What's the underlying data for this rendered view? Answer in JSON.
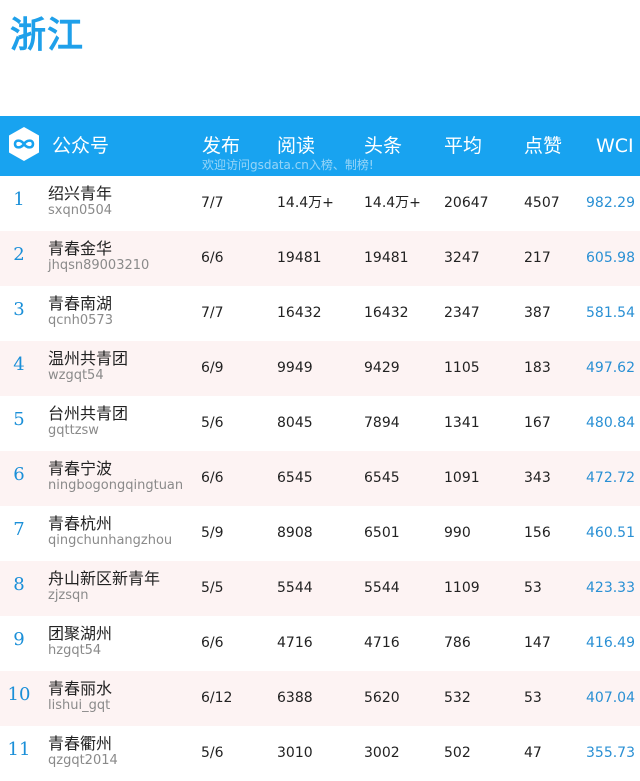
{
  "page": {
    "title": "浙江"
  },
  "header": {
    "account_label": "公众号",
    "publish_label": "发布",
    "read_label": "阅读",
    "top_label": "头条",
    "avg_label": "平均",
    "likes_label": "点赞",
    "wci_label": "WCI",
    "watermark": "欢迎访问gsdata.cn入榜、制榜!",
    "logo_icon": "infinity-logo-icon"
  },
  "colors": {
    "title": "#1fa0ea",
    "header_bg": "#18a3f0",
    "rank": "#1a8fd8",
    "wci": "#2a90d4",
    "alt_row": "#fdf3f3"
  },
  "rows": [
    {
      "rank": "1",
      "name": "绍兴青年",
      "id": "sxqn0504",
      "publish": "7/7",
      "read": "14.4万+",
      "top": "14.4万+",
      "avg": "20647",
      "likes": "4507",
      "wci": "982.29"
    },
    {
      "rank": "2",
      "name": "青春金华",
      "id": "jhqsn89003210",
      "publish": "6/6",
      "read": "19481",
      "top": "19481",
      "avg": "3247",
      "likes": "217",
      "wci": "605.98"
    },
    {
      "rank": "3",
      "name": "青春南湖",
      "id": "qcnh0573",
      "publish": "7/7",
      "read": "16432",
      "top": "16432",
      "avg": "2347",
      "likes": "387",
      "wci": "581.54"
    },
    {
      "rank": "4",
      "name": "温州共青团",
      "id": "wzgqt54",
      "publish": "6/9",
      "read": "9949",
      "top": "9429",
      "avg": "1105",
      "likes": "183",
      "wci": "497.62"
    },
    {
      "rank": "5",
      "name": "台州共青团",
      "id": "gqttzsw",
      "publish": "5/6",
      "read": "8045",
      "top": "7894",
      "avg": "1341",
      "likes": "167",
      "wci": "480.84"
    },
    {
      "rank": "6",
      "name": "青春宁波",
      "id": "ningbogongqingtuan",
      "publish": "6/6",
      "read": "6545",
      "top": "6545",
      "avg": "1091",
      "likes": "343",
      "wci": "472.72"
    },
    {
      "rank": "7",
      "name": "青春杭州",
      "id": "qingchunhangzhou",
      "publish": "5/9",
      "read": "8908",
      "top": "6501",
      "avg": "990",
      "likes": "156",
      "wci": "460.51"
    },
    {
      "rank": "8",
      "name": "舟山新区新青年",
      "id": "zjzsqn",
      "publish": "5/5",
      "read": "5544",
      "top": "5544",
      "avg": "1109",
      "likes": "53",
      "wci": "423.33"
    },
    {
      "rank": "9",
      "name": "团聚湖州",
      "id": "hzgqt54",
      "publish": "6/6",
      "read": "4716",
      "top": "4716",
      "avg": "786",
      "likes": "147",
      "wci": "416.49"
    },
    {
      "rank": "10",
      "name": "青春丽水",
      "id": "lishui_gqt",
      "publish": "6/12",
      "read": "6388",
      "top": "5620",
      "avg": "532",
      "likes": "53",
      "wci": "407.04"
    },
    {
      "rank": "11",
      "name": "青春衢州",
      "id": "qzgqt2014",
      "publish": "5/6",
      "read": "3010",
      "top": "3002",
      "avg": "502",
      "likes": "47",
      "wci": "355.73"
    }
  ]
}
